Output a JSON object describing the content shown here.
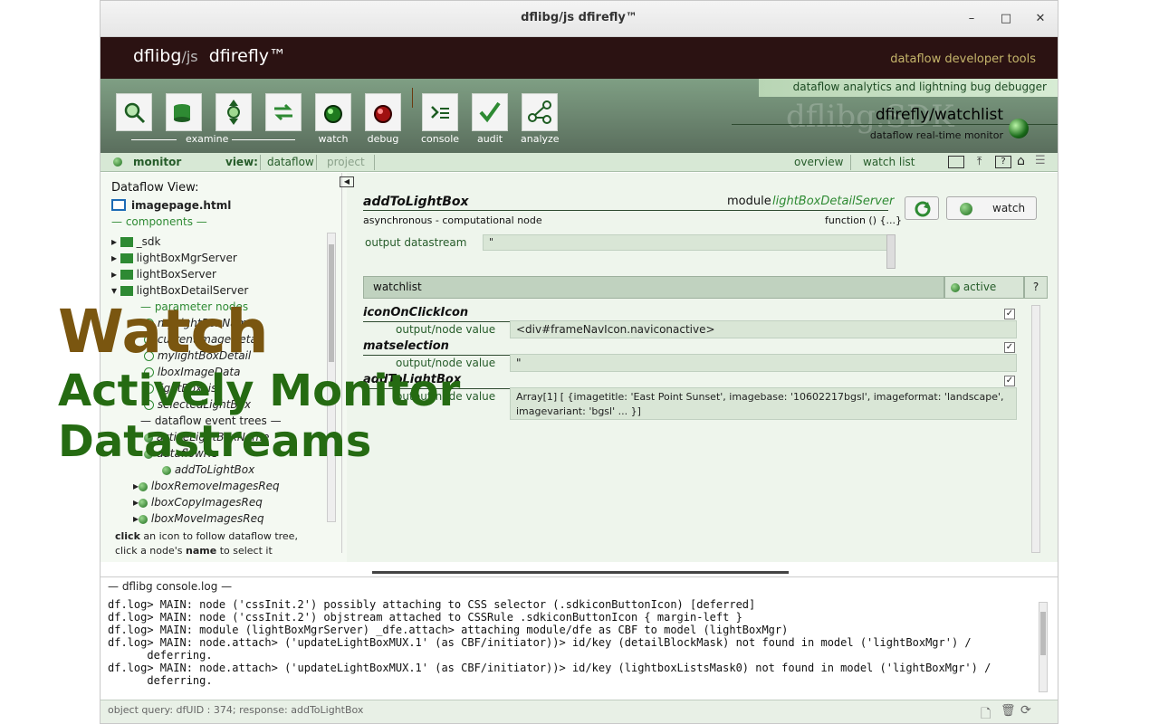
{
  "window": {
    "title": "dflibg/js dfirefly™"
  },
  "banner": {
    "brand": "dflibg",
    "slash": "/js",
    "product": "dfirefly™",
    "tagline": "dataflow developer tools"
  },
  "toolbar": {
    "stripe": "dataflow analytics and lightning bug debugger",
    "group_label": "examine",
    "buttons": [
      {
        "label": ""
      },
      {
        "label": ""
      },
      {
        "label": ""
      },
      {
        "label": ""
      },
      {
        "label": "watch"
      },
      {
        "label": "debug"
      },
      {
        "label": "console"
      },
      {
        "label": "audit"
      },
      {
        "label": "analyze"
      }
    ],
    "right_title": "dfirefly/watchlist",
    "right_sub": "dataflow real-time monitor",
    "watermark": "dflibg.SDK"
  },
  "navbar": {
    "monitor": "monitor",
    "view_label": "view:",
    "dataflow": "dataflow",
    "project": "project",
    "overview": "overview",
    "watchlist": "watch list"
  },
  "left": {
    "title": "Dataflow View:",
    "file": "imagepage.html",
    "components_header": "— components —",
    "items": [
      "_sdk",
      "lightBoxMgrServer",
      "lightBoxServer",
      "lightBoxDetailServer"
    ],
    "param_header": "— parameter nodes",
    "params": [
      "myLightBoxName",
      "currentImageDetail",
      "mylightBoxDetail",
      "lboxImageData",
      "lightBoxList",
      "selectedLightBox"
    ],
    "events_header": "— dataflow event trees —",
    "events": [
      "activeLightBoxName",
      "lboxRemoveImagesReq",
      "lboxCopyImagesReq",
      "lboxMoveImagesReq"
    ],
    "subnode": "addToLightBox",
    "events_partial": "dataflowRe",
    "hint1a": "click",
    "hint1b": " an icon to follow dataflow tree,",
    "hint2a": "click a node's ",
    "hint2b": "name",
    "hint2c": " to select it"
  },
  "main": {
    "node_name": "addToLightBox",
    "module_label": "module",
    "module_name": "lightBoxDetailServer",
    "node_type": "asynchronous - computational node",
    "function_label": "function () {...}",
    "output_label": "output  datastream",
    "output_value": "\"",
    "watch_btn": "watch",
    "watchlist_header": "watchlist",
    "active_label": "active",
    "help_label": "?",
    "entries": [
      {
        "name": "iconOnClickIcon",
        "field": "output/node  value",
        "value": "<div#frameNavIcon.naviconactive>"
      },
      {
        "name": "matselection",
        "field": "output/node  value",
        "value": "\""
      },
      {
        "name": "addToLightBox",
        "field": "output/node  value",
        "value": "Array[1] [ {imagetitle: 'East Point Sunset', imagebase: '10602217bgsl', imageformat: 'landscape', imagevariant: 'bgsl' ... }]"
      }
    ]
  },
  "console": {
    "header": "— dflibg console.log —",
    "lines": [
      "df.log> MAIN: node ('cssInit.2') possibly attaching to CSS selector (.sdkiconButtonIcon) [deferred]",
      "df.log> MAIN: node ('cssInit.2') objstream attached to CSSRule .sdkiconButtonIcon { margin-left }",
      "df.log> MAIN: module (lightBoxMgrServer) _dfe.attach> attaching module/dfe as CBF to model (lightBoxMgr)",
      "df.log> MAIN: node.attach> ('updateLightBoxMUX.1' (as CBF/initiator))> id/key (detailBlockMask) not found in model ('lightBoxMgr') /",
      "      deferring.",
      "df.log> MAIN: node.attach> ('updateLightBoxMUX.1' (as CBF/initiator))> id/key (lightboxListsMask0) not found in model ('lightBoxMgr') /",
      "      deferring."
    ]
  },
  "status": {
    "query": "object query: dfUID : 374; response: addToLightBox"
  },
  "overlay": {
    "line1": "Watch",
    "line2": "Actively Monitor",
    "line3": "Datastreams"
  },
  "colors": {
    "banner": "#2b1212",
    "accent": "#265c2a",
    "tagline": "#c4b46a",
    "overlay_brown": "#7a5610",
    "overlay_green": "#256b12"
  }
}
